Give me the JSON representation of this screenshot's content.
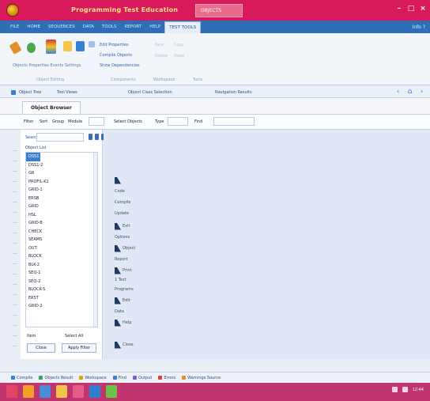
{
  "window": {
    "title": "Programming Test Education",
    "active_tab": "OBJECTS",
    "controls": [
      "–",
      "□",
      "×"
    ]
  },
  "menu": {
    "items": [
      "FILE",
      "HOME",
      "SEQUENCES",
      "DATA",
      "TOOLS",
      "REPORT",
      "HELP",
      "TEST TOOLS"
    ],
    "active_index": 7,
    "right_text": "Info  ?"
  },
  "ribbon": {
    "caption": "Objects Properties Events Settings",
    "links": [
      "Edit Properties",
      "Compile Objects",
      "Show Dependencies"
    ],
    "faded": [
      "New",
      "Copy",
      "Delete",
      "Paste"
    ],
    "groups": [
      "Object Editing",
      "Components",
      "Workspace",
      "Tools"
    ]
  },
  "subbar": {
    "items": [
      "Object Tree",
      "Tool Views",
      "Object Class Selection",
      "Navigation Results"
    ]
  },
  "document_tab": {
    "label": "Object Browser"
  },
  "filter": {
    "items": [
      "Filter",
      "Sort",
      "Group",
      "Module",
      "Select Objects",
      "Type",
      "Find"
    ]
  },
  "sidebar": {
    "search_label": "Search",
    "list_label": "Object List",
    "items": [
      "DSS1",
      "DSS1-2",
      "GR",
      "PROFIL-K1",
      "GRID-1",
      "ERSB",
      "GRID",
      "HSL",
      "GRID-B",
      "CHECK",
      "SEAMS",
      "OUT",
      "BLOCK",
      "BLK-2",
      "SEQ-1",
      "SEQ-2",
      "BLOCK-S",
      "ERST",
      "GRID-2"
    ],
    "selected_index": 0,
    "footer_left": "Item",
    "footer_right": "Select All",
    "buttons": [
      "Close",
      "Apply Filter"
    ]
  },
  "main": {
    "rows": [
      "",
      "Code",
      "Compile",
      "Update",
      "Exit",
      "Options",
      "Object",
      "Report",
      "Print",
      "1 Test",
      "Programs",
      "Edit",
      "Data",
      "Help",
      "",
      "Close"
    ]
  },
  "statusbar": {
    "items": [
      "Compile",
      "Objects Result",
      "Workspace",
      "Find",
      "Output",
      "Errors",
      "Warnings Source"
    ],
    "colors": [
      "#3a7fd1",
      "#3aa05a",
      "#d9a21b",
      "#3a7fd1",
      "#8a5cc2",
      "#d2413a",
      "#e0902c"
    ]
  },
  "taskbar": {
    "icon_names": [
      "windows-start-icon",
      "app-icon",
      "explorer-icon",
      "folder-icon",
      "media-icon",
      "browser-icon",
      "calculator-icon"
    ],
    "icon_colors": [
      "#e24466",
      "#f0a02a",
      "#4a8cd8",
      "#f3c64a",
      "#e85a8a",
      "#2f7fd1",
      "#6dc04a"
    ],
    "clock": "12:44"
  }
}
